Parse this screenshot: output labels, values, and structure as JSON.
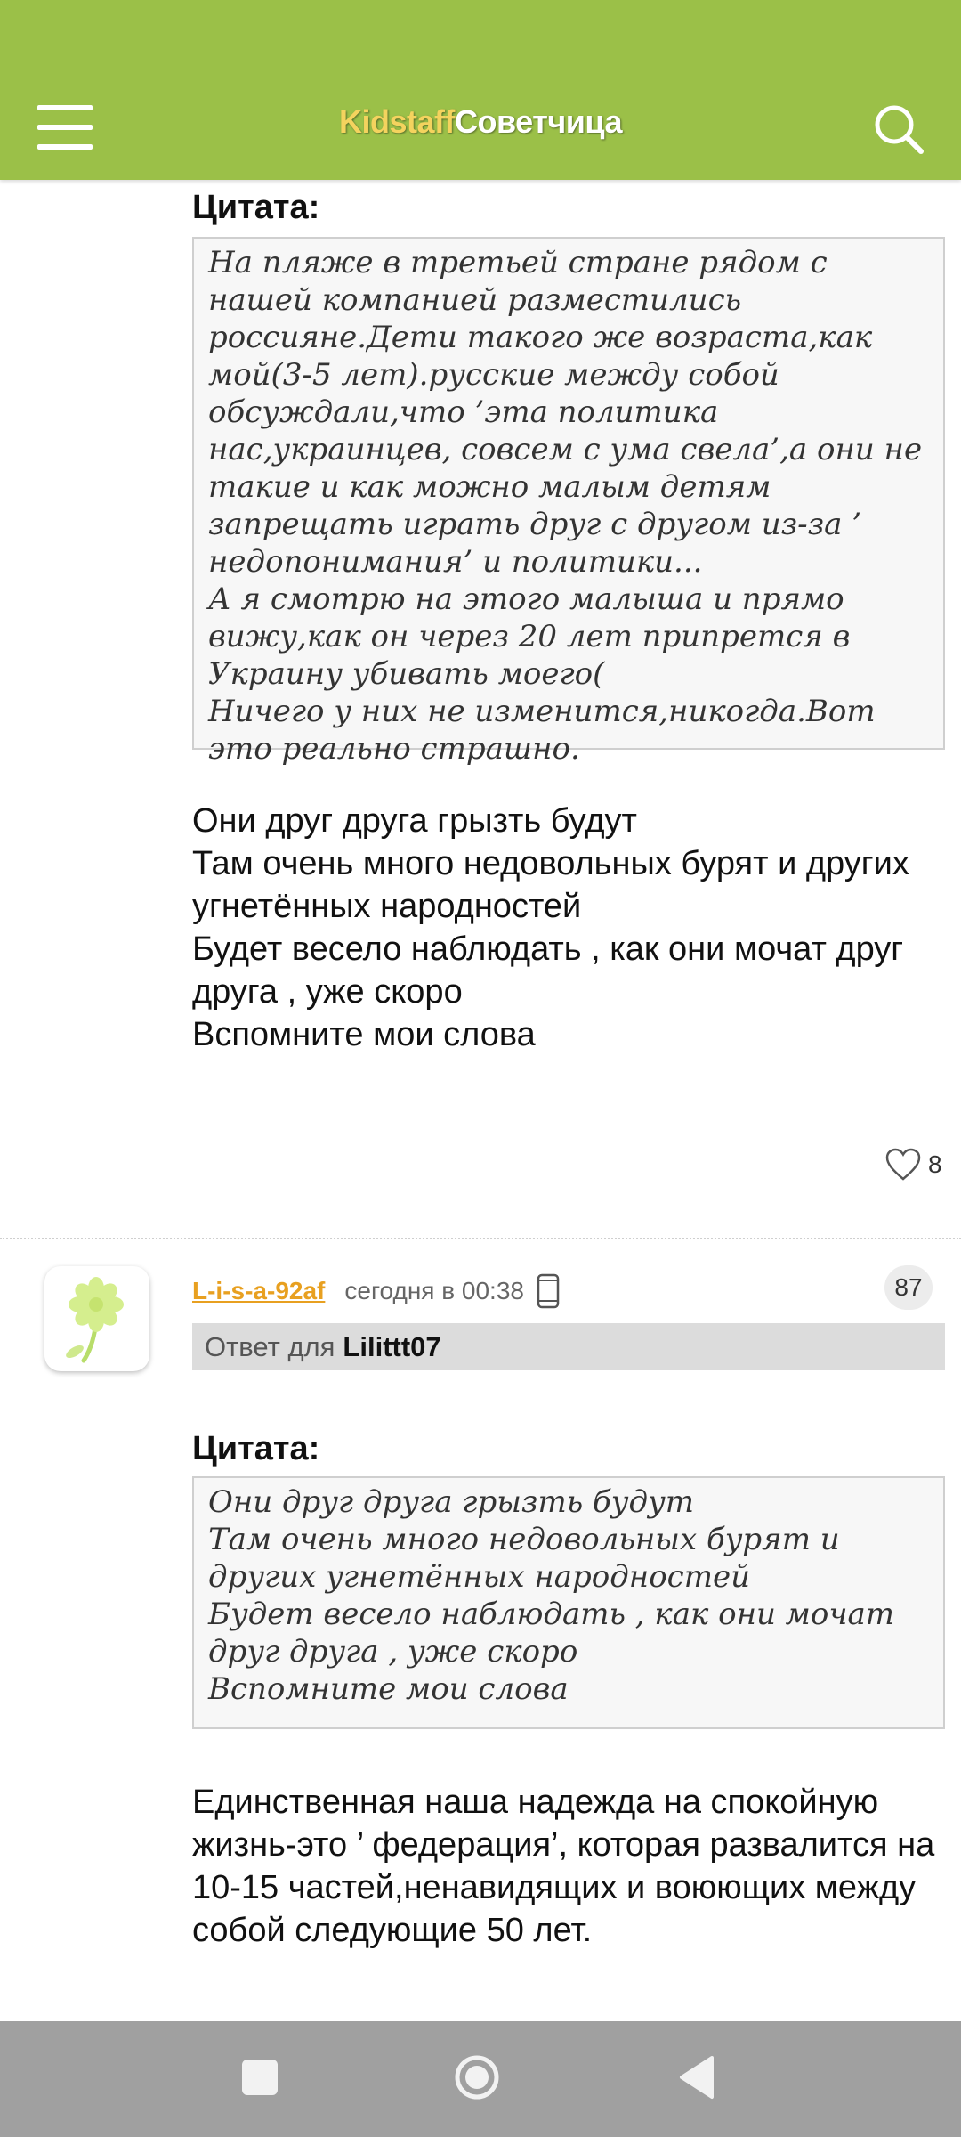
{
  "header": {
    "brand_part1": "Kidstaff",
    "brand_part2": "Советчица",
    "colors": {
      "bar": "#9bc048",
      "brand_part1": "#f4d35e",
      "brand_part2": "#ffffff"
    }
  },
  "post1": {
    "quote_title": "Цитата:",
    "quote_text": "На пляже в третьей стране рядом с нашей компанией разместились россияне.Дети такого же возраста,как мой(3-5 лет).русские между собой обсуждали,что ’эта политика нас,украинцев, совсем с ума свела’,а они не такие и как можно малым детям запрещать играть друг с другом из-за ’ недопонимания’ и политики...\nА я смотрю на этого малыша и прямо вижу,как он через 20 лет припрется в Украину убивать моего(\nНичего у них не изменится,никогда.Вот это реально страшно.",
    "body": "Они друг друга грызть будут\nТам очень много недовольных бурят и других угнетённых народностей\nБудет весело наблюдать , как они мочат друг друга , уже скоро\nВспомните мои слова",
    "likes": "8"
  },
  "post2": {
    "username": "L-i-s-a-92af",
    "timestamp": "сегодня в 00:38",
    "device_icon": "phone-icon",
    "post_number": "87",
    "reply_label": "Ответ для",
    "reply_to": "Lilittt07",
    "quote_title": "Цитата:",
    "quote_text": "Они друг друга грызть будут\nТам очень много недовольных бурят и других угнетённых народностей\nБудет весело наблюдать , как они мочат друг друга , уже скоро\nВспомните мои слова",
    "body": "Единственная наша надежда на спокойную жизнь-это ’ федерация’, которая развалится на 10-15 частей,ненавидящих и воюющих между собой следующие 50 лет."
  },
  "navbar": {
    "buttons": [
      "recent-apps-icon",
      "home-icon",
      "back-icon"
    ]
  }
}
